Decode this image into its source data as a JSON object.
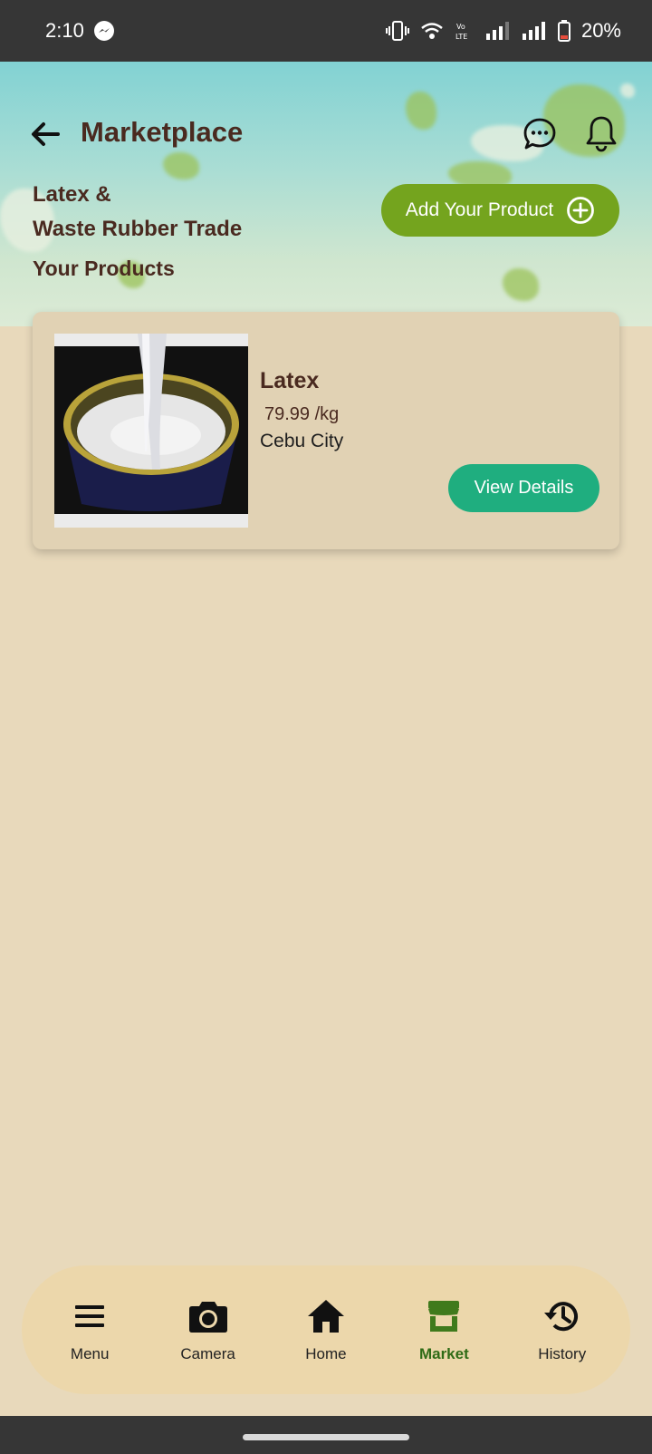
{
  "status_bar": {
    "time": "2:10",
    "battery": "20%",
    "icons": [
      "messenger-icon",
      "vibrate-icon",
      "wifi-icon",
      "volte-icon",
      "signal-icon",
      "signal-icon",
      "battery-icon"
    ]
  },
  "header": {
    "title": "Marketplace",
    "subtitle_line1": "Latex &",
    "subtitle_line2": "Waste Rubber Trade",
    "section_title": "Your Products",
    "add_button_label": "Add Your Product"
  },
  "products": [
    {
      "name": "Latex",
      "price": " 79.99 /kg",
      "location": "Cebu City",
      "button_label": "View Details"
    }
  ],
  "bottom_nav": {
    "items": [
      {
        "label": "Menu",
        "icon": "menu-icon"
      },
      {
        "label": "Camera",
        "icon": "camera-icon"
      },
      {
        "label": "Home",
        "icon": "home-icon"
      },
      {
        "label": "Market",
        "icon": "market-icon",
        "active": true
      },
      {
        "label": "History",
        "icon": "history-icon"
      }
    ]
  },
  "colors": {
    "background": "#e8d9bb",
    "title_text": "#4a2a20",
    "accent_green": "#74a41e",
    "button_teal": "#1fae7f",
    "nav_active": "#2f6b16"
  }
}
